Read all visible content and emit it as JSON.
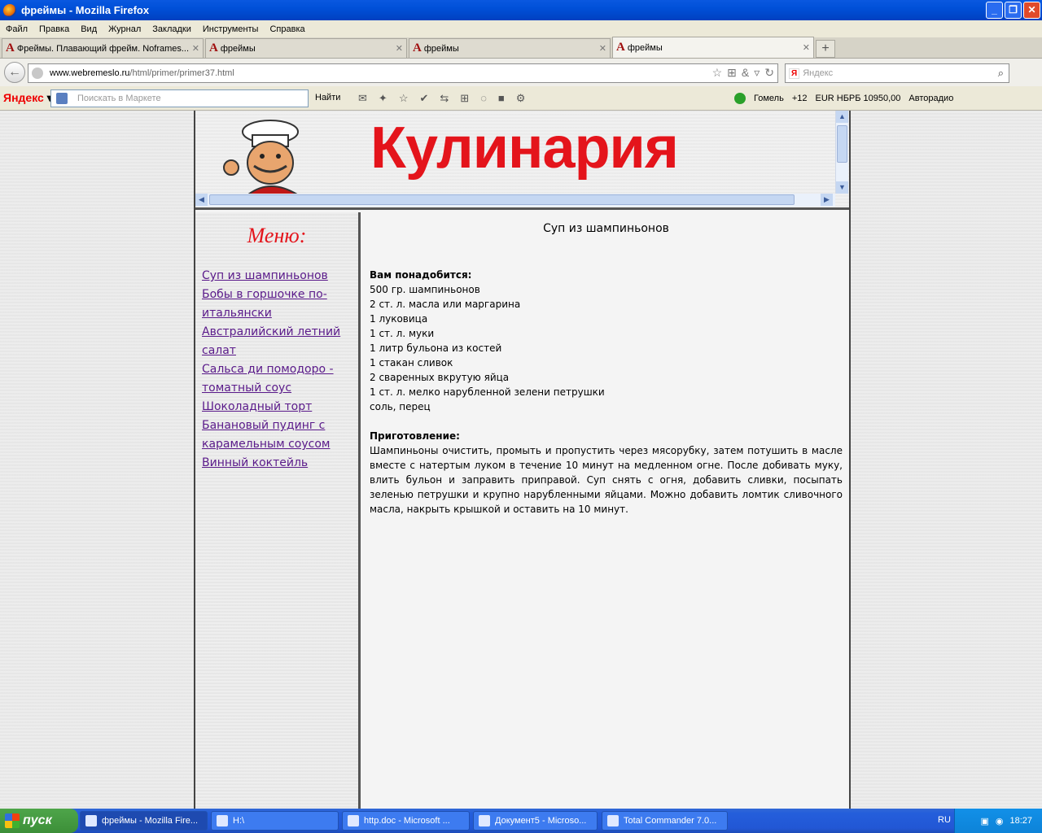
{
  "window": {
    "title": "фреймы - Mozilla Firefox"
  },
  "menubar": [
    "Файл",
    "Правка",
    "Вид",
    "Журнал",
    "Закладки",
    "Инструменты",
    "Справка"
  ],
  "tabs": [
    {
      "label": "Фреймы. Плавающий фрейм. Noframes...",
      "active": false
    },
    {
      "label": "фреймы",
      "active": false
    },
    {
      "label": "фреймы",
      "active": false
    },
    {
      "label": "фреймы",
      "active": true
    }
  ],
  "nav": {
    "url_domain": "www.webremeslo.ru",
    "url_path": "/html/primer/primer37.html",
    "search_placeholder": "Яндекс",
    "search_engine_badge": "Я"
  },
  "yandex_bar": {
    "logo": "Яндекс",
    "market_placeholder": "Поискать в Маркете",
    "find_label": "Найти",
    "city": "Гомель",
    "weather": "+12",
    "currency": "EUR НБРБ 10950,00",
    "radio": "Авторадио"
  },
  "page": {
    "brand": "Кулинария",
    "menu_title": "Меню:",
    "menu_links": [
      "Суп из шампиньонов",
      "Бобы в горшочке по-итальянски",
      "Австралийский летний салат",
      "Сальса ди помодоро - томатный соус",
      "Шоколадный торт",
      "Банановый пудинг с карамельным соусом",
      "Винный коктейль"
    ],
    "recipe": {
      "title": "Суп из шампиньонов",
      "needs_head": "Вам понадобится:",
      "ingredients": [
        "500 гр. шампиньонов",
        "2 ст. л. масла или маргарина",
        "1 луковица",
        "1 ст. л. муки",
        "1 литр бульона из костей",
        "1 стакан сливок",
        "2 сваренных вкрутую яйца",
        "1 ст. л. мелко нарубленной зелени петрушки",
        "соль, перец"
      ],
      "method_head": "Приготовление:",
      "method": "Шампиньоны очистить, промыть и пропустить через мясорубку, затем потушить в масле вместе с натертым луком в течение 10 минут на медленном огне. После добивать муку, влить бульон и заправить приправой. Суп снять с огня, добавить сливки, посыпать зеленью петрушки и крупно нарубленными яйцами. Можно добавить ломтик сливочного масла, накрыть крышкой и оставить на 10 минут."
    }
  },
  "taskbar": {
    "start": "пуск",
    "tasks": [
      "фреймы - Mozilla Fire...",
      "H:\\",
      "http.doc - Microsoft ...",
      "Документ5 - Microso...",
      "Total Commander 7.0..."
    ],
    "lang": "RU",
    "clock": "18:27"
  },
  "colors": {
    "brand_red": "#e4141b",
    "link_purple": "#5a1a8a",
    "xp_blue": "#245edb"
  }
}
